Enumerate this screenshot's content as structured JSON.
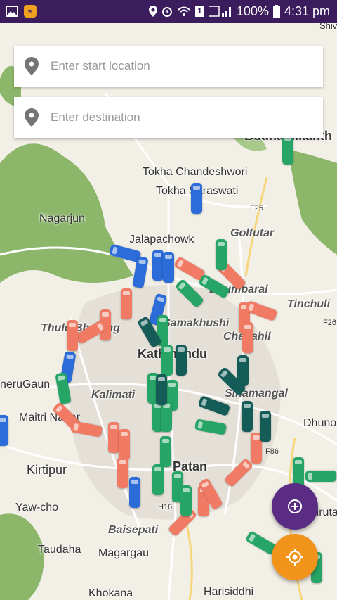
{
  "status_bar": {
    "left_icons": [
      "image-icon",
      "app-icon"
    ],
    "right_icons": [
      "location-icon",
      "alarm-icon",
      "wifi-icon",
      "sim-icon",
      "signal-icon",
      "battery-icon"
    ],
    "battery": "100%",
    "time": "4:31 pm"
  },
  "search": {
    "start_placeholder": "Enter start location",
    "destination_placeholder": "Enter destination"
  },
  "map": {
    "labels": [
      "Shiv",
      "Budhanilkanth",
      "Tokha Chandeshwori",
      "Tokha Saraswati",
      "Nagarjun",
      "Golfutar",
      "F25",
      "Jalapachowk",
      "Dhumbarai",
      "Tinchuli",
      "Thulo Bharang",
      "Samakhushi",
      "Chabahil",
      "F26",
      "Kathmandu",
      "neruGaun",
      "Sinamangal",
      "Kalimati",
      "Maitri Nagar",
      "Dhuno",
      "Kirtipur",
      "Patan",
      "F86",
      "Yaw-cho",
      "H16",
      "Sirutar",
      "Baisepati",
      "Taudaha",
      "Magargau",
      "Harisiddhi",
      "Khokana"
    ]
  },
  "colors": {
    "status_bar": "#3b1d5e",
    "zoom_fab": "#5b2c83",
    "location_fab": "#f2941c",
    "bus_blue": "#2b6cd8",
    "bus_red": "#f07a63",
    "bus_green": "#27a567",
    "bus_dark": "#155c58"
  },
  "fabs": {
    "zoom_icon": "zoom-plus-icon",
    "location_icon": "my-location-icon"
  }
}
